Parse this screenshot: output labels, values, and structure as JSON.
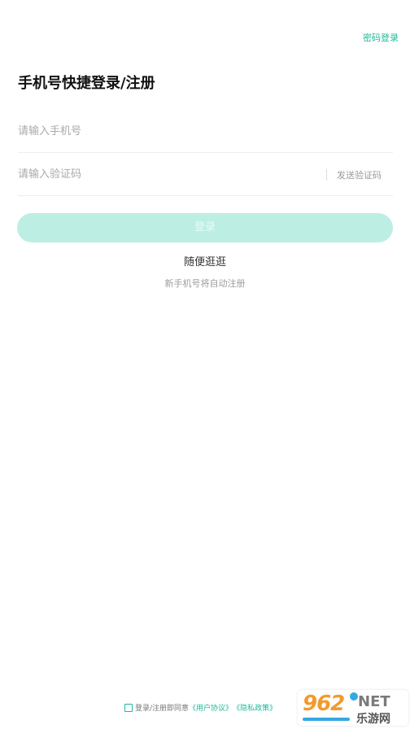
{
  "header": {
    "password_login": "密码登录"
  },
  "title": "手机号快捷登录/注册",
  "form": {
    "phone_placeholder": "请输入手机号",
    "code_placeholder": "请输入验证码",
    "send_code": "发送验证码",
    "login_button": "登录"
  },
  "browse": "随便逛逛",
  "hint": "新手机号将自动注册",
  "agreement": {
    "text": "登录/注册即同意",
    "user_agreement": "《用户协议》",
    "privacy_policy": "《隐私政策》",
    "checked": false
  },
  "watermark": {
    "number": "962",
    "suffix": "NET",
    "sub": "乐游网"
  },
  "colors": {
    "accent": "#1fb89a",
    "button_disabled": "#bdeee4"
  }
}
